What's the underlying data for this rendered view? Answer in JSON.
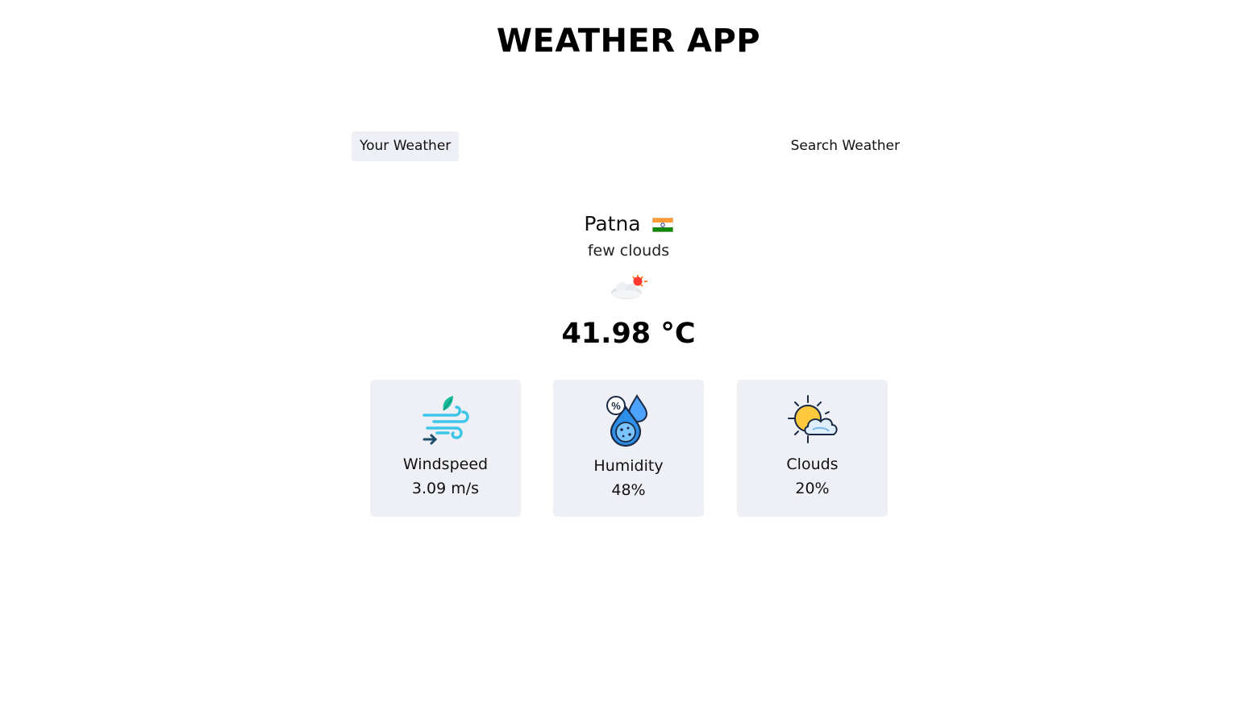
{
  "app": {
    "title": "WEATHER APP"
  },
  "tabs": [
    {
      "label": "Your Weather",
      "active": true
    },
    {
      "label": "Search Weather",
      "active": false
    }
  ],
  "weather": {
    "city": "Patna",
    "country_flag": "india-flag-icon",
    "description": "few clouds",
    "condition_icon": "few-clouds-icon",
    "temperature": "41.98 °C"
  },
  "stats": [
    {
      "icon": "wind-icon",
      "label": "Windspeed",
      "value": "3.09 m/s"
    },
    {
      "icon": "humidity-icon",
      "label": "Humidity",
      "value": "48%"
    },
    {
      "icon": "clouds-icon",
      "label": "Clouds",
      "value": "20%"
    }
  ],
  "colors": {
    "card_bg": "#eef0f6",
    "tab_active_bg": "#eef0f6",
    "text": "#111111"
  }
}
